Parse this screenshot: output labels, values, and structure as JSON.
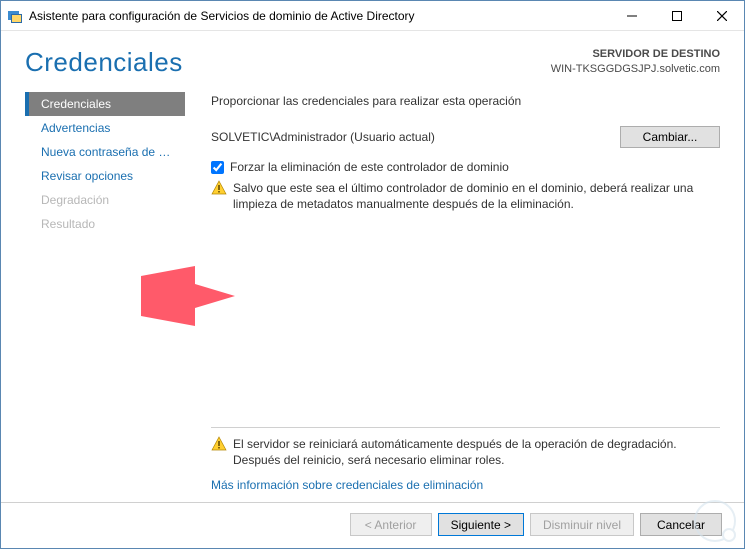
{
  "titlebar": {
    "text": "Asistente para configuración de Servicios de dominio de Active Directory"
  },
  "header": {
    "title": "Credenciales",
    "target_label": "SERVIDOR DE DESTINO",
    "target_value": "WIN-TKSGGDGSJPJ.solvetic.com"
  },
  "sidebar": {
    "items": [
      {
        "label": "Credenciales",
        "state": "active"
      },
      {
        "label": "Advertencias",
        "state": "enabled"
      },
      {
        "label": "Nueva contraseña de ad...",
        "state": "enabled"
      },
      {
        "label": "Revisar opciones",
        "state": "enabled"
      },
      {
        "label": "Degradación",
        "state": "disabled"
      },
      {
        "label": "Resultado",
        "state": "disabled"
      }
    ]
  },
  "main": {
    "instruction": "Proporcionar las credenciales para realizar esta operación",
    "user": "SOLVETIC\\Administrador (Usuario actual)",
    "change_button": "Cambiar...",
    "force_checkbox_label": "Forzar la eliminación de este controlador de dominio",
    "force_checked": true,
    "force_warning": "Salvo que este sea el último controlador de dominio en el dominio, deberá realizar una limpieza de metadatos manualmente después de la eliminación.",
    "restart_warning": "El servidor se reiniciará automáticamente después de la operación de degradación. Después del reinicio, será necesario eliminar roles.",
    "more_info_link": "Más información sobre credenciales de eliminación"
  },
  "footer": {
    "prev": "< Anterior",
    "next": "Siguiente >",
    "demote": "Disminuir nivel",
    "cancel": "Cancelar"
  }
}
